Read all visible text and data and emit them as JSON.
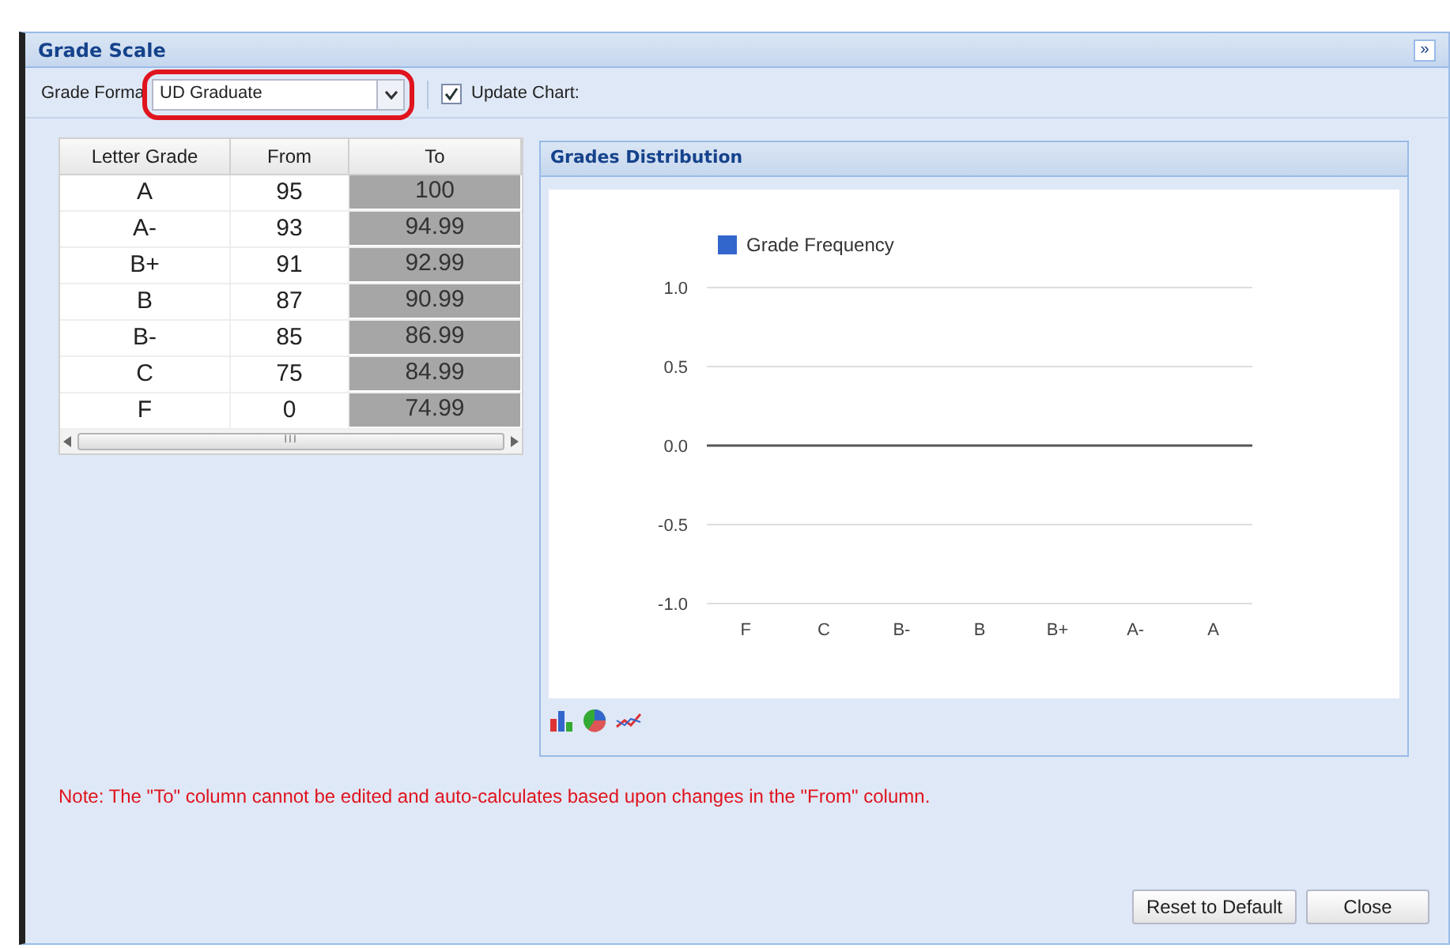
{
  "window": {
    "title": "Grade Scale",
    "collapse": "»"
  },
  "toolbar": {
    "format_label": "Grade Forma",
    "format_value": "UD Graduate",
    "highlighted": true,
    "update_chart": {
      "label": "Update Chart:",
      "checked": true
    }
  },
  "table": {
    "columns": [
      "Letter Grade",
      "From",
      "To"
    ],
    "rows": [
      [
        "A",
        "95",
        "100"
      ],
      [
        "A-",
        "93",
        "94.99"
      ],
      [
        "B+",
        "91",
        "92.99"
      ],
      [
        "B",
        "87",
        "90.99"
      ],
      [
        "B-",
        "85",
        "86.99"
      ],
      [
        "C",
        "75",
        "84.99"
      ],
      [
        "F",
        "0",
        "74.99"
      ]
    ],
    "scrollbar_grip": "III"
  },
  "chart_panel": {
    "title": "Grades Distribution",
    "chart_data": {
      "type": "bar",
      "categories": [
        "F",
        "C",
        "B-",
        "B",
        "B+",
        "A-",
        "A"
      ],
      "series": [
        {
          "name": "Grade Frequency",
          "color": "#3366cc",
          "values": [
            0,
            0,
            0,
            0,
            0,
            0,
            0
          ]
        }
      ],
      "ylim": [
        -1,
        1
      ],
      "yticks": [
        {
          "value": 1,
          "label": "1.0"
        },
        {
          "value": 0.5,
          "label": "0.5"
        },
        {
          "value": 0,
          "label": "0.0"
        },
        {
          "value": -0.5,
          "label": "-0.5"
        },
        {
          "value": -1,
          "label": "-1.0"
        }
      ]
    }
  },
  "note": "Note: The \"To\" column cannot be edited and auto-calculates based upon changes in the \"From\" column.",
  "buttons": [
    "Reset to Default",
    "Close"
  ]
}
